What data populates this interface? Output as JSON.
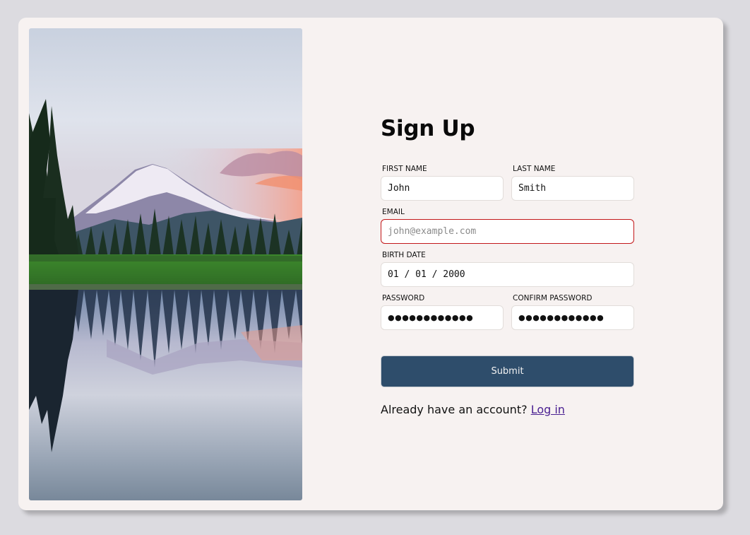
{
  "form": {
    "title": "Sign Up",
    "first_name": {
      "label": "FIRST NAME",
      "value": "John"
    },
    "last_name": {
      "label": "LAST NAME",
      "value": "Smith"
    },
    "email": {
      "label": "EMAIL",
      "value": "",
      "placeholder": "john@example.com",
      "state": "invalid"
    },
    "birth_date": {
      "label": "BIRTH DATE",
      "value": "01 / 01 / 2000"
    },
    "password": {
      "label": "PASSWORD",
      "value": "●●●●●●●●●●●●"
    },
    "confirm_password": {
      "label": "CONFIRM PASSWORD",
      "value": "●●●●●●●●●●●●"
    },
    "submit_label": "Submit",
    "login_prompt": "Already have an account?",
    "login_link": "Log in"
  },
  "image": {
    "description_icon": "mountain-lake-photo"
  },
  "colors": {
    "page_bg": "#dcdbe0",
    "card_bg": "#f7f2f1",
    "button_bg": "#2e4d6b",
    "error_border": "#c3181a",
    "link": "#4b2192"
  }
}
